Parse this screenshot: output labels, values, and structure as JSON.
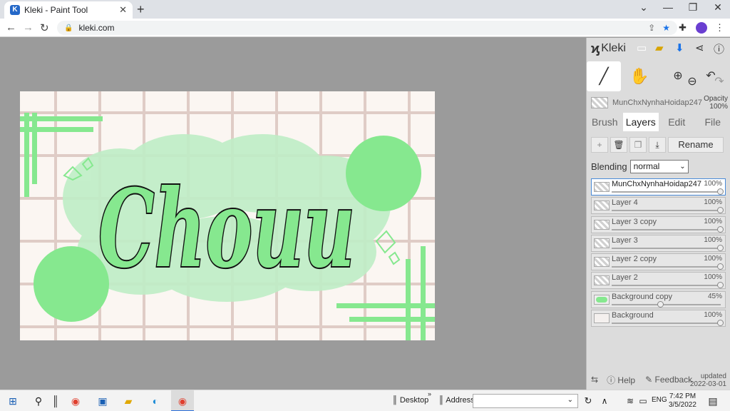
{
  "browser": {
    "tab_title": "Kleki - Paint Tool",
    "tab_favicon": "K",
    "new_tab_glyph": "+",
    "close_glyph": "✕",
    "url": "kleki.com"
  },
  "app": {
    "logo_text": "Kleki",
    "tabs": [
      "Brush",
      "Layers",
      "Edit",
      "File"
    ],
    "active_tab": "Layers",
    "current_layer_name": "MunChxNynhaHoidap247",
    "opacity_label": "Opacity",
    "opacity_value": "100%",
    "rename_label": "Rename",
    "blending_label": "Blending",
    "blending_value": "normal",
    "layers": [
      {
        "name": "MunChxNynhaHoidap247",
        "opacity": "100%",
        "opacity_fraction": 1.0,
        "selected": true
      },
      {
        "name": "Layer 4",
        "opacity": "100%",
        "opacity_fraction": 1.0,
        "selected": false
      },
      {
        "name": "Layer 3 copy",
        "opacity": "100%",
        "opacity_fraction": 1.0,
        "selected": false
      },
      {
        "name": "Layer 3",
        "opacity": "100%",
        "opacity_fraction": 1.0,
        "selected": false
      },
      {
        "name": "Layer 2 copy",
        "opacity": "100%",
        "opacity_fraction": 1.0,
        "selected": false
      },
      {
        "name": "Layer 2",
        "opacity": "100%",
        "opacity_fraction": 1.0,
        "selected": false
      },
      {
        "name": "Background copy",
        "opacity": "45%",
        "opacity_fraction": 0.45,
        "selected": false
      },
      {
        "name": "Background",
        "opacity": "100%",
        "opacity_fraction": 1.0,
        "selected": false
      }
    ],
    "help_label": "Help",
    "feedback_label": "Feedback",
    "updated_label": "updated",
    "updated_date": "2022-03-01"
  },
  "canvas": {
    "text": "Chouu",
    "accent_color": "#86e88f",
    "light_green": "#bfeec6",
    "grid_color": "#c9aaa3"
  },
  "taskbar": {
    "desktop_label": "Desktop",
    "address_label": "Address",
    "lang": "ENG",
    "time": "7:42 PM",
    "date": "3/5/2022"
  }
}
